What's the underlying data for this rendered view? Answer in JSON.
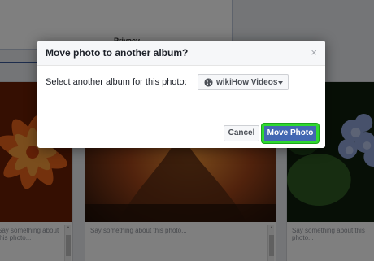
{
  "dialog": {
    "title": "Move photo to another album?",
    "close_glyph": "×",
    "prompt": "Select another album for this photo:",
    "album_select": {
      "value": "wikiHow Videos",
      "icon": "globe-icon"
    },
    "buttons": {
      "cancel": "Cancel",
      "move": "Move Photo"
    }
  },
  "background": {
    "privacy_label": "Privacy",
    "caption_placeholder": "Say something about this photo..."
  },
  "colors": {
    "primary_button": "#4267b2",
    "highlight": "#2fd92f",
    "header_bg": "#f6f7f9"
  }
}
